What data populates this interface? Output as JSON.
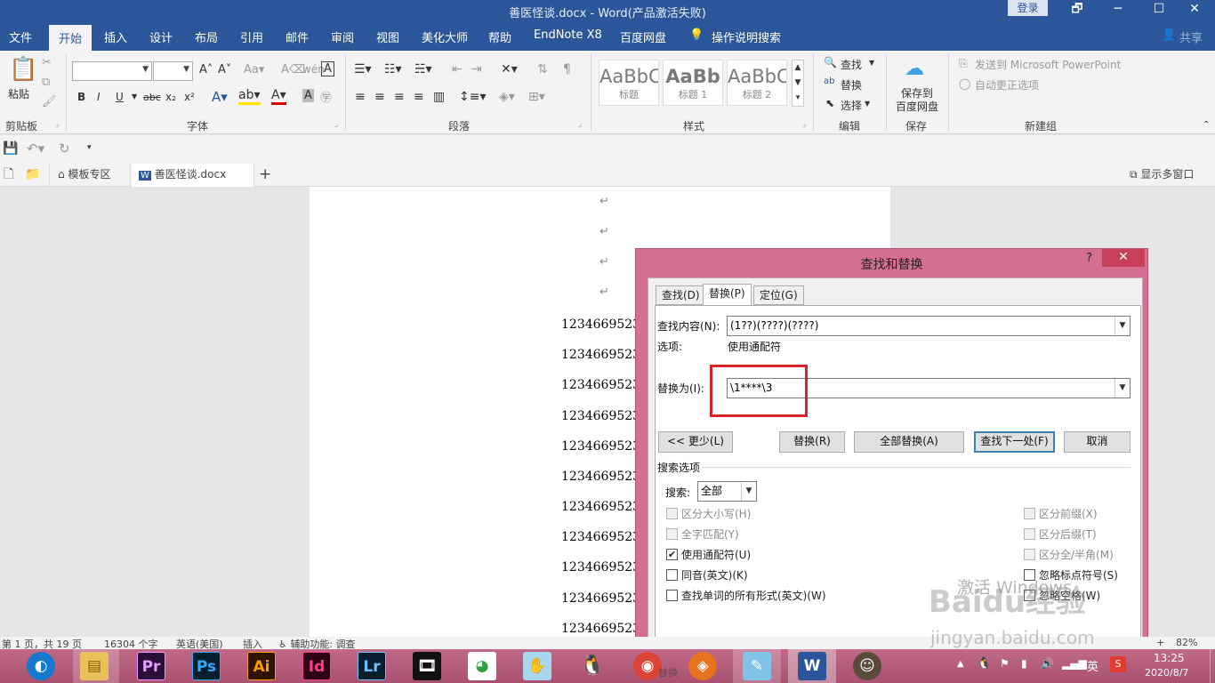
{
  "window": {
    "title": "善医怪谈.docx  -  Word(产品激活失败)",
    "login": "登录",
    "controls": [
      "🗗",
      "─",
      "☐",
      "✕"
    ]
  },
  "ribbon_tabs": [
    "文件",
    "开始",
    "插入",
    "设计",
    "布局",
    "引用",
    "邮件",
    "审阅",
    "视图",
    "美化大师",
    "帮助",
    "EndNote X8",
    "百度网盘"
  ],
  "tell_me": "操作说明搜索",
  "share": "共享",
  "ribbon": {
    "clipboard": {
      "paste": "粘贴",
      "label": "剪贴板"
    },
    "font": {
      "label": "字体",
      "buttons": [
        "B",
        "I",
        "U",
        "abc",
        "x₂",
        "x²"
      ]
    },
    "paragraph": {
      "label": "段落"
    },
    "styles": {
      "label": "样式",
      "items": [
        {
          "sample": "AaBbC",
          "name": "标题"
        },
        {
          "sample": "AaBb",
          "name": "标题 1"
        },
        {
          "sample": "AaBbC",
          "name": "标题 2"
        }
      ]
    },
    "editing": {
      "label": "编辑",
      "find": "查找",
      "replace": "替换",
      "select": "选择"
    },
    "save": {
      "label": "保存",
      "button": "保存到\n百度网盘",
      "line1": "保存到",
      "line2": "百度网盘"
    },
    "newgroup": {
      "label": "新建组",
      "send_ppt": "发送到 Microsoft PowerPoint",
      "autocorrect": "自动更正选项"
    }
  },
  "doc_tabs": {
    "templates": "模板专区",
    "document": "善医怪谈.docx",
    "multi_window": "显示多窗口"
  },
  "document": {
    "lines": [
      "1234669523",
      "1234669523",
      "1234669523",
      "1234669523",
      "1234669523",
      "1234669523",
      "1234669523",
      "1234669523",
      "1234669523",
      "1234669523",
      "1234669523"
    ],
    "para_mark": "↵"
  },
  "dialog": {
    "title": "查找和替换",
    "help": "?",
    "tabs": [
      "查找(D)",
      "替换(P)",
      "定位(G)"
    ],
    "find_label": "查找内容(N):",
    "find_value": "(1??)(????)(????)",
    "options_label": "选项:",
    "options_value": "使用通配符",
    "replace_label": "替换为(I):",
    "replace_value": "\\1****\\3",
    "buttons": {
      "less": "<< 更少(L)",
      "replace": "替换(R)",
      "replace_all": "全部替换(A)",
      "find_next": "查找下一处(F)",
      "cancel": "取消"
    },
    "search_options_title": "搜索选项",
    "search_label": "搜索:",
    "search_value": "全部",
    "checks_left": [
      {
        "label": "区分大小写(H)",
        "checked": false,
        "disabled": true
      },
      {
        "label": "全字匹配(Y)",
        "checked": false,
        "disabled": true
      },
      {
        "label": "使用通配符(U)",
        "checked": true,
        "disabled": false
      },
      {
        "label": "同音(英文)(K)",
        "checked": false,
        "disabled": false
      },
      {
        "label": "查找单词的所有形式(英文)(W)",
        "checked": false,
        "disabled": false
      }
    ],
    "checks_right": [
      {
        "label": "区分前缀(X)",
        "checked": false,
        "disabled": true
      },
      {
        "label": "区分后缀(T)",
        "checked": false,
        "disabled": true
      },
      {
        "label": "区分全/半角(M)",
        "checked": false,
        "disabled": true
      },
      {
        "label": "忽略标点符号(S)",
        "checked": false,
        "disabled": false
      },
      {
        "label": "忽略空格(W)",
        "checked": false,
        "disabled": false
      }
    ]
  },
  "status_bar": {
    "page": "第 1 页，共 19 页",
    "words": "16304 个字",
    "language": "英语(美国)",
    "mode": "插入",
    "accessibility": "辅助功能: 调查",
    "zoom": "82%"
  },
  "taskbar": {
    "apps": [
      "Pr",
      "Ps",
      "Ai",
      "Id",
      "Lr"
    ],
    "time": "13:25",
    "date": "2020/8/7",
    "ime": "英",
    "hidden_label": "替换"
  },
  "watermark": {
    "text1": "激活 Windows",
    "text2": "jingyan.baidu.com",
    "text3": "Baidu经验"
  },
  "colors": {
    "word_blue": "#2b579a",
    "dialog_frame": "#d56f8f",
    "highlight_box": "#d9232b",
    "taskbar": "#b35a79"
  }
}
